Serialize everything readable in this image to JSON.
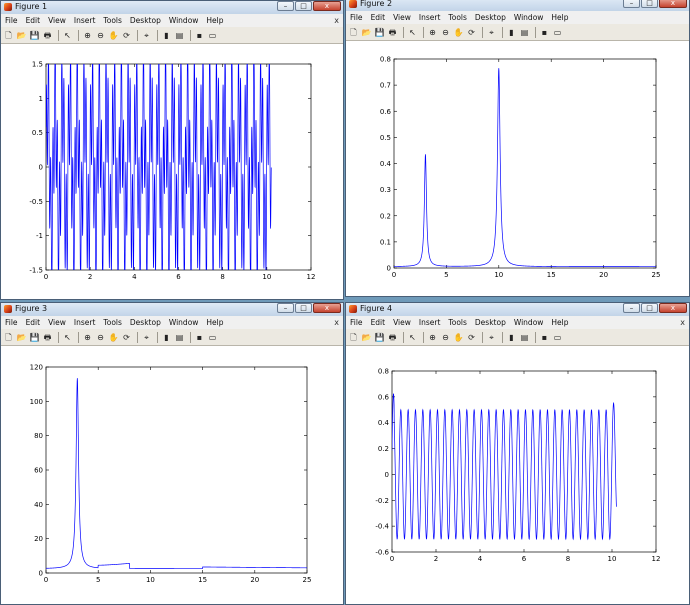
{
  "menu_labels": [
    "File",
    "Edit",
    "View",
    "Insert",
    "Tools",
    "Desktop",
    "Window",
    "Help"
  ],
  "window_controls": {
    "minimize": "–",
    "maximize": "□",
    "close": "x",
    "menu_close": "x"
  },
  "toolbar_icons": [
    "new-figure-icon",
    "open-file-icon",
    "save-icon",
    "print-icon",
    "select-arrow-icon",
    "zoom-in-icon",
    "zoom-out-icon",
    "pan-hand-icon",
    "rotate-3d-icon",
    "data-cursor-icon",
    "colorbar-icon",
    "legend-icon",
    "hide-plot-tools-icon",
    "show-plot-tools-icon"
  ],
  "toolbar_glyphs": [
    "🗋",
    "📂",
    "💾",
    "🖶",
    "↖",
    "⊕",
    "⊖",
    "✋",
    "⟳",
    "⌖",
    "▮",
    "▤",
    "▪",
    "▭"
  ],
  "figures": [
    {
      "title": "Figure 1",
      "chart_data": {
        "type": "line",
        "title": "",
        "xlabel": "",
        "ylabel": "",
        "xlim": [
          0,
          12
        ],
        "ylim": [
          -1.5,
          1.5
        ],
        "xticks": [
          0,
          2,
          4,
          6,
          8,
          10,
          12
        ],
        "yticks": [
          -1.5,
          -1,
          -0.5,
          0,
          0.5,
          1,
          1.5
        ],
        "series": [
          {
            "color": "#0000ff",
            "x_range": [
              0,
              10.2
            ],
            "signal": "sin(2*pi*3*t)+sin(2*pi*10*t)",
            "approx_range": [
              -1.3,
              1.5
            ]
          }
        ]
      }
    },
    {
      "title": "Figure 2",
      "chart_data": {
        "type": "line",
        "title": "",
        "xlabel": "",
        "ylabel": "",
        "xlim": [
          0,
          25
        ],
        "ylim": [
          0,
          0.8
        ],
        "xticks": [
          0,
          5,
          10,
          15,
          20,
          25
        ],
        "yticks": [
          0,
          0.1,
          0.2,
          0.3,
          0.4,
          0.5,
          0.6,
          0.7,
          0.8
        ],
        "series": [
          {
            "color": "#0000ff",
            "peaks": [
              {
                "x": 3,
                "y": 0.43,
                "width": 0.12
              },
              {
                "x": 10,
                "y": 0.76,
                "width": 0.15
              }
            ],
            "baseline": 0.005
          }
        ]
      }
    },
    {
      "title": "Figure 3",
      "chart_data": {
        "type": "line",
        "title": "",
        "xlabel": "",
        "ylabel": "",
        "xlim": [
          0,
          25
        ],
        "ylim": [
          0,
          120
        ],
        "xticks": [
          0,
          5,
          10,
          15,
          20,
          25
        ],
        "yticks": [
          0,
          20,
          40,
          60,
          80,
          100,
          120
        ],
        "series": [
          {
            "color": "#0000ff",
            "peaks": [
              {
                "x": 3,
                "y": 111,
                "width": 0.14
              }
            ],
            "baseline": 2.5,
            "extra_segments": [
              {
                "x0": 5,
                "x1": 8,
                "y0": 1.5,
                "y1": 3
              },
              {
                "x0": 15,
                "x1": 25,
                "y0": 1,
                "y1": 0.5
              }
            ]
          }
        ]
      }
    },
    {
      "title": "Figure 4",
      "chart_data": {
        "type": "line",
        "title": "",
        "xlabel": "",
        "ylabel": "",
        "xlim": [
          0,
          12
        ],
        "ylim": [
          -0.6,
          0.8
        ],
        "xticks": [
          0,
          2,
          4,
          6,
          8,
          10,
          12
        ],
        "yticks": [
          -0.6,
          -0.4,
          -0.2,
          0,
          0.2,
          0.4,
          0.6,
          0.8
        ],
        "series": [
          {
            "color": "#0000ff",
            "x_range": [
              0,
              10.2
            ],
            "signal": "0.5*sin(2*pi*3*t)",
            "approx_range": [
              -0.52,
              0.66
            ]
          }
        ]
      }
    }
  ]
}
